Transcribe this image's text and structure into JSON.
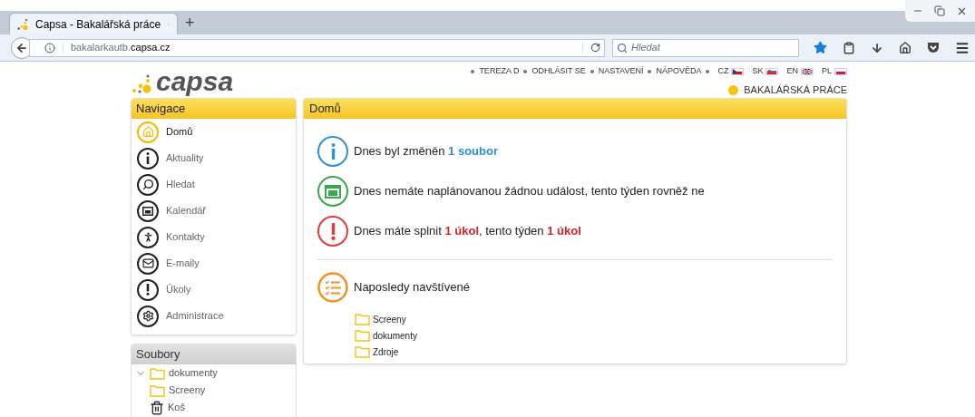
{
  "browser": {
    "tab_title": "Capsa - Bakalářská práce",
    "new_tab": "+",
    "url_subdomain": "bakalarkautb.",
    "url_domain": "capsa.cz",
    "search_placeholder": "Hledat"
  },
  "logo": {
    "text": "capsa"
  },
  "top_links": [
    {
      "label": "TEREZA D"
    },
    {
      "label": "ODHLÁSIT SE"
    },
    {
      "label": "NASTAVENÍ"
    },
    {
      "label": "NÁPOVĚDA"
    }
  ],
  "languages": [
    {
      "label": "CZ"
    },
    {
      "label": "SK"
    },
    {
      "label": "EN"
    },
    {
      "label": "PL"
    }
  ],
  "project": {
    "name": "BAKALÁŘSKÁ PRÁCE"
  },
  "navigation": {
    "title": "Navigace",
    "items": [
      {
        "label": "Domů",
        "kind": "home",
        "selected": true
      },
      {
        "label": "Aktuality",
        "kind": "info",
        "selected": false
      },
      {
        "label": "Hledat",
        "kind": "search",
        "selected": false
      },
      {
        "label": "Kalendář",
        "kind": "calendar",
        "selected": false
      },
      {
        "label": "Kontakty",
        "kind": "person",
        "selected": false
      },
      {
        "label": "E-maily",
        "kind": "mail",
        "selected": false
      },
      {
        "label": "Úkoly",
        "kind": "task",
        "selected": false
      },
      {
        "label": "Administrace",
        "kind": "gear",
        "selected": false
      }
    ]
  },
  "files": {
    "title": "Soubory",
    "items": [
      {
        "label": "dokumenty",
        "kind": "folder",
        "expanded": true
      },
      {
        "label": "Screeny",
        "kind": "folder",
        "expanded": false
      },
      {
        "label": "Koš",
        "kind": "trash",
        "expanded": false
      }
    ]
  },
  "main": {
    "title": "Domů",
    "messages": [
      {
        "kind": "info",
        "text": "Dnes byl změněn **1 soubor**"
      },
      {
        "kind": "calendar",
        "text": "Dnes nemáte naplánovanou žádnou událost, tento týden rovněž ne"
      },
      {
        "kind": "task",
        "text": "Dnes máte splnit **1 úkol**, tento týden **1 úkol**"
      }
    ],
    "recent": {
      "title": "Naposledy navštívené",
      "items": [
        {
          "label": "Screeny"
        },
        {
          "label": "dokumenty"
        },
        {
          "label": "Zdroje"
        }
      ]
    }
  }
}
